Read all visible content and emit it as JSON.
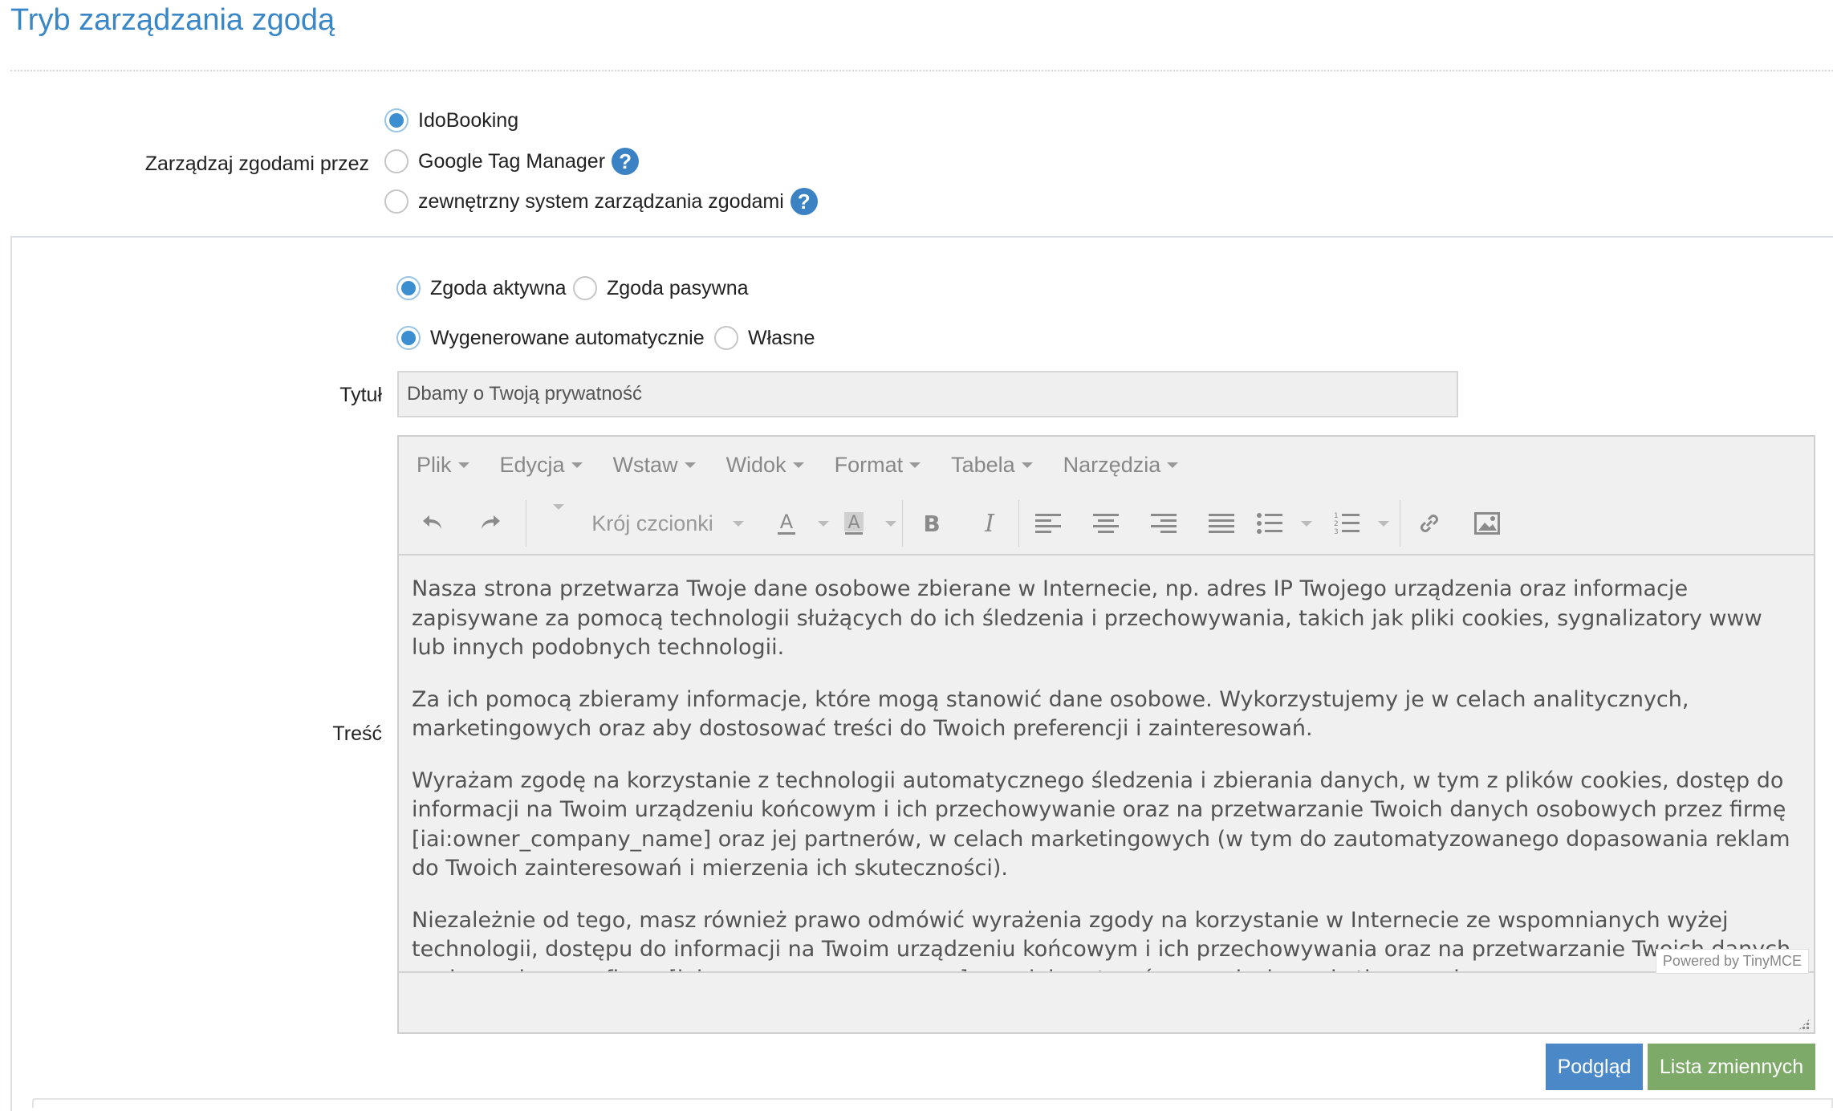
{
  "page": {
    "title": "Tryb zarządzania zgodą"
  },
  "manage": {
    "label": "Zarządzaj zgodami przez",
    "options": [
      {
        "label": "IdoBooking",
        "checked": true
      },
      {
        "label": "Google Tag Manager",
        "checked": false
      },
      {
        "label": "zewnętrzny system zarządzania zgodami",
        "checked": false
      }
    ]
  },
  "consent_type": {
    "options": [
      {
        "label": "Zgoda aktywna",
        "checked": true
      },
      {
        "label": "Zgoda pasywna",
        "checked": false
      }
    ]
  },
  "generation": {
    "options": [
      {
        "label": "Wygenerowane automatycznie",
        "checked": true
      },
      {
        "label": "Własne",
        "checked": false
      }
    ]
  },
  "title_field": {
    "label": "Tytuł",
    "value": "Dbamy o Twoją prywatność"
  },
  "content_field": {
    "label": "Treść"
  },
  "editor": {
    "menu": [
      "Plik",
      "Edycja",
      "Wstaw",
      "Widok",
      "Format",
      "Tabela",
      "Narzędzia"
    ],
    "font_select": "Krój czcionki",
    "paragraphs": [
      "Nasza strona przetwarza Twoje dane osobowe zbierane w Internecie, np. adres IP Twojego urządzenia oraz informacje zapisywane za pomocą technologii służących do ich śledzenia i przechowywania, takich jak pliki cookies, sygnalizatory www lub innych podobnych technologii.",
      "Za ich pomocą zbieramy informacje, które mogą stanowić dane osobowe. Wykorzystujemy je w celach analitycznych, marketingowych oraz aby dostosować treści do Twoich preferencji i zainteresowań.",
      "Wyrażam zgodę na korzystanie z technologii automatycznego śledzenia i zbierania danych, w tym z plików cookies, dostęp do informacji na Twoim urządzeniu końcowym i ich przechowywanie oraz na przetwarzanie Twoich danych osobowych przez firmę [iai:owner_company_name] oraz jej partnerów, w celach marketingowych (w tym do zautomatyzowanego dopasowania reklam do Twoich zainteresowań i mierzenia ich skuteczności).",
      "Niezależnie od tego, masz również prawo odmówić wyrażenia zgody na korzystanie w Internecie ze wspomnianych wyżej technologii, dostępu do informacji na Twoim urządzeniu końcowym i ich przechowywania oraz na przetwarzanie Twoich danych osobowych przez firmę [iai:owner_company_name] oraz jej partnerów, w celach marketingowych."
    ],
    "powered_by": "Powered by TinyMCE"
  },
  "buttons": {
    "preview": "Podgląd",
    "variables": "Lista zmiennych"
  },
  "colors": {
    "accent": "#3a87c8",
    "preview_btn": "#4a88c7",
    "vars_btn": "#7daa69"
  }
}
